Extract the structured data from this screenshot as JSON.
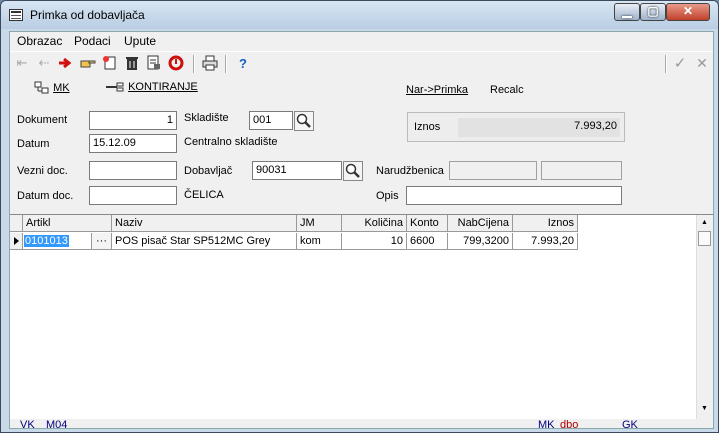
{
  "window": {
    "title": "Primka od dobavljača"
  },
  "menu": [
    {
      "label": "Obrazac"
    },
    {
      "label": "Podaci"
    },
    {
      "label": "Upute"
    }
  ],
  "toolbar": {
    "help_glyph": "?",
    "confirm_glyph": "✓",
    "cancel_glyph": "✕"
  },
  "actions": {
    "mk_label": "MK",
    "kontiranje_label": "KONTIRANJE",
    "nar_primka_label": "Nar->Primka",
    "recalc_label": "Recalc"
  },
  "form": {
    "dokument": {
      "label": "Dokument",
      "value": "1"
    },
    "datum": {
      "label": "Datum",
      "value": "15.12.09"
    },
    "skladiste": {
      "label": "Skladište",
      "value": "001",
      "name": "Centralno skladište"
    },
    "vezni_doc": {
      "label": "Vezni doc.",
      "value": ""
    },
    "datum_doc": {
      "label": "Datum doc.",
      "value": ""
    },
    "dobavljac": {
      "label": "Dobavljač",
      "value": "90031",
      "name": "ČELICA"
    },
    "narudzbenica": {
      "label": "Narudžbenica",
      "value1": "",
      "value2": ""
    },
    "opis": {
      "label": "Opis",
      "value": ""
    },
    "iznos": {
      "label": "Iznos",
      "value": "7.993,20"
    }
  },
  "grid": {
    "columns": [
      "Artikl",
      "Naziv",
      "JM",
      "Količina",
      "Konto",
      "NabCijena",
      "Iznos"
    ],
    "rows": [
      {
        "artikl": "0101013",
        "lookup": "···",
        "naziv": "POS pisač Star SP512MC Grey",
        "jm": "kom",
        "kolicina": "10",
        "konto": "6600",
        "nabcijena": "799,3200",
        "iznos": "7.993,20"
      }
    ]
  },
  "status": {
    "vk": "VK",
    "m04": "M04",
    "mk": "MK",
    "dbo": "dbo",
    "gk": "GK"
  },
  "colors": {
    "selection": "#3399ff",
    "status_blue": "#000080",
    "status_red": "#aa0000"
  }
}
